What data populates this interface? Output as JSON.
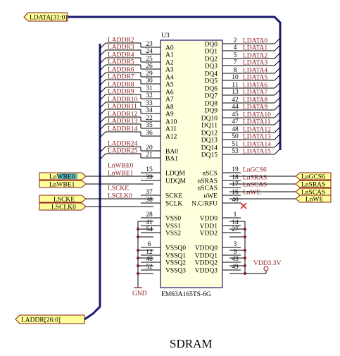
{
  "colors": {
    "bus": "#1a1a6e",
    "wire": "#000000",
    "net_label": "#8b1a1a",
    "port_fill": "#ffff99",
    "port_border": "#8b1a1a",
    "highlight": "#5fbfbf",
    "chip_fill": "#ffffdd",
    "chip_border": "#1a1a6e",
    "junction": "#8b1a1a",
    "no_connect": "#cc0000",
    "power": "#8b1a1a"
  },
  "ports": {
    "ldata_bus": "LDATA[31:0]",
    "laddr_bus": "LADDR[26:0]",
    "lnwbe0": "LnWBE0",
    "lnwbe1": "LnWBE1",
    "lscke": "LSCKE",
    "lsclk0": "LSCLK0",
    "lngcs6": "LnGCS6",
    "lnsras": "LnSRAS",
    "lnscas": "LnSCAS",
    "lnwe": "LnWE"
  },
  "chip": {
    "refdes": "U3",
    "part": "EM63A165TS-6G",
    "left_pins": [
      {
        "num": "23",
        "name": "A0",
        "net": "LADDR2"
      },
      {
        "num": "24",
        "name": "A1",
        "net": "LADDR3"
      },
      {
        "num": "25",
        "name": "A2",
        "net": "LADDR4"
      },
      {
        "num": "26",
        "name": "A3",
        "net": "LADDR5"
      },
      {
        "num": "29",
        "name": "A4",
        "net": "LADDR6"
      },
      {
        "num": "30",
        "name": "A5",
        "net": "LADDR7"
      },
      {
        "num": "31",
        "name": "A6",
        "net": "LADDR8"
      },
      {
        "num": "32",
        "name": "A7",
        "net": "LADDR9"
      },
      {
        "num": "33",
        "name": "A8",
        "net": "LADDR10"
      },
      {
        "num": "34",
        "name": "A9",
        "net": "LADDR11"
      },
      {
        "num": "22",
        "name": "A10",
        "net": "LADDR12"
      },
      {
        "num": "35",
        "name": "A11",
        "net": "LADDR13"
      },
      {
        "num": "36",
        "name": "A12",
        "net": "LADDR14"
      },
      {
        "num": "20",
        "name": "BA0",
        "net": "LADDR24"
      },
      {
        "num": "21",
        "name": "BA1",
        "net": "LADDR25"
      },
      {
        "num": "15",
        "name": "LDQM",
        "net": "LnWBE0"
      },
      {
        "num": "39",
        "name": "UDQM",
        "net": "LnWBE1"
      },
      {
        "num": "37",
        "name": "SCKE",
        "net": "LSCKE"
      },
      {
        "num": "38",
        "name": "SCLK",
        "net": "LSCLK0"
      },
      {
        "num": "28",
        "name": "VSS0",
        "net": ""
      },
      {
        "num": "41",
        "name": "VSS1",
        "net": ""
      },
      {
        "num": "54",
        "name": "VSS2",
        "net": ""
      },
      {
        "num": "6",
        "name": "VSSQ0",
        "net": ""
      },
      {
        "num": "12",
        "name": "VSSQ1",
        "net": ""
      },
      {
        "num": "46",
        "name": "VSSQ2",
        "net": ""
      },
      {
        "num": "52",
        "name": "VSSQ3",
        "net": ""
      }
    ],
    "right_pins": [
      {
        "num": "2",
        "name": "DQ0",
        "net": "LDATA0"
      },
      {
        "num": "4",
        "name": "DQ1",
        "net": "LDATA1"
      },
      {
        "num": "5",
        "name": "DQ2",
        "net": "LDATA2"
      },
      {
        "num": "7",
        "name": "DQ3",
        "net": "LDATA3"
      },
      {
        "num": "8",
        "name": "DQ4",
        "net": "LDATA4"
      },
      {
        "num": "10",
        "name": "DQ5",
        "net": "LDATA5"
      },
      {
        "num": "11",
        "name": "DQ6",
        "net": "LDATA6"
      },
      {
        "num": "13",
        "name": "DQ7",
        "net": "LDATA7"
      },
      {
        "num": "42",
        "name": "DQ8",
        "net": "LDATA8"
      },
      {
        "num": "44",
        "name": "DQ9",
        "net": "LDATA9"
      },
      {
        "num": "45",
        "name": "DQ10",
        "net": "LDATA10"
      },
      {
        "num": "47",
        "name": "DQ11",
        "net": "LDATA11"
      },
      {
        "num": "48",
        "name": "DQ12",
        "net": "LDATA12"
      },
      {
        "num": "50",
        "name": "DQ13",
        "net": "LDATA13"
      },
      {
        "num": "51",
        "name": "DQ14",
        "net": "LDATA14"
      },
      {
        "num": "53",
        "name": "DQ15",
        "net": "LDATA15"
      },
      {
        "num": "19",
        "name": "nSCS",
        "net": "LnGCS6"
      },
      {
        "num": "18",
        "name": "nSRAS",
        "net": "LnSRAS"
      },
      {
        "num": "17",
        "name": "nSCAS",
        "net": "LnSCAS"
      },
      {
        "num": "16",
        "name": "nWE",
        "net": "LnWE"
      },
      {
        "num": "40",
        "name": "N.C/RFU",
        "net": ""
      },
      {
        "num": "1",
        "name": "VDD0",
        "net": ""
      },
      {
        "num": "14",
        "name": "VDD1",
        "net": ""
      },
      {
        "num": "27",
        "name": "VDD2",
        "net": ""
      },
      {
        "num": "3",
        "name": "VDDQ0",
        "net": ""
      },
      {
        "num": "9",
        "name": "VDDQ1",
        "net": ""
      },
      {
        "num": "43",
        "name": "VDDQ2",
        "net": ""
      },
      {
        "num": "49",
        "name": "VDDQ3",
        "net": ""
      }
    ]
  },
  "power": {
    "gnd": "GND",
    "vdd": "VDD3.3V"
  },
  "title": "SDRAM"
}
